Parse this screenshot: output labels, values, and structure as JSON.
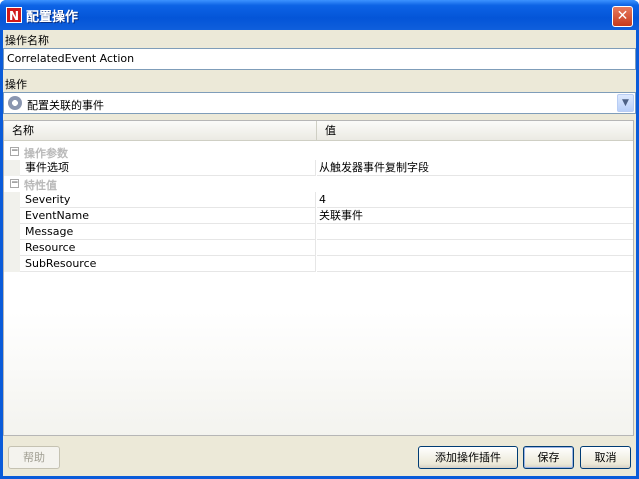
{
  "window": {
    "title": "配置操作",
    "app_icon_letter": "N",
    "close_glyph": "✕"
  },
  "form": {
    "action_name_label": "操作名称",
    "action_name_value": "CorrelatedEvent Action",
    "action_label": "操作",
    "action_selected": "配置关联的事件",
    "action_icon": "gear-icon"
  },
  "grid": {
    "columns": [
      "名称",
      "值"
    ],
    "categories": [
      {
        "label": "操作参数",
        "toggle": "−",
        "rows": [
          {
            "name": "事件选项",
            "value": "从触发器事件复制字段"
          }
        ]
      },
      {
        "label": "特性值",
        "toggle": "−",
        "rows": [
          {
            "name": "Severity",
            "value": "4"
          },
          {
            "name": "EventName",
            "value": "关联事件"
          },
          {
            "name": "Message",
            "value": ""
          },
          {
            "name": "Resource",
            "value": ""
          },
          {
            "name": "SubResource",
            "value": ""
          }
        ]
      }
    ]
  },
  "buttons": {
    "help": "帮助",
    "add_plugin": "添加操作插件",
    "save": "保存",
    "cancel": "取消"
  }
}
